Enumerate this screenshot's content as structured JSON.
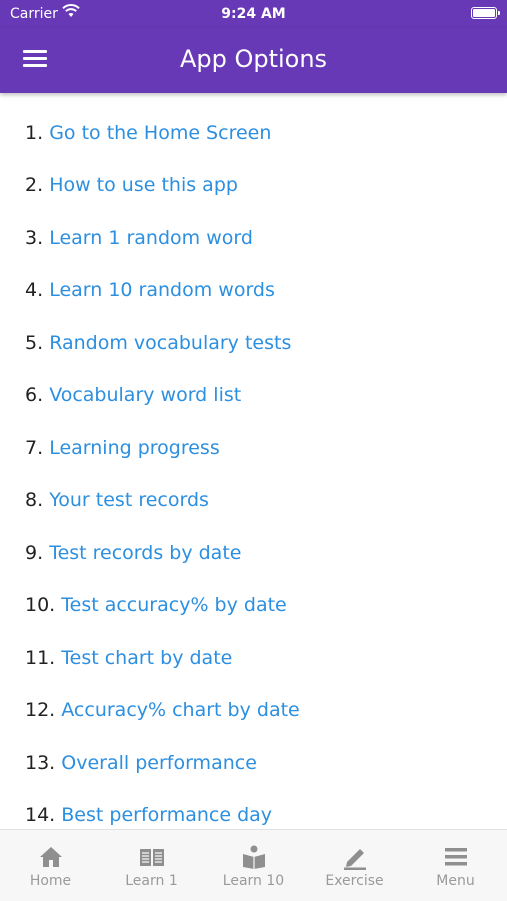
{
  "status_bar": {
    "carrier": "Carrier",
    "time": "9:24 AM"
  },
  "header": {
    "title": "App Options"
  },
  "options": [
    {
      "number": "1.",
      "label": "Go to the Home Screen"
    },
    {
      "number": "2.",
      "label": "How to use this app"
    },
    {
      "number": "3.",
      "label": "Learn 1 random word"
    },
    {
      "number": "4.",
      "label": "Learn 10 random words"
    },
    {
      "number": "5.",
      "label": "Random vocabulary tests"
    },
    {
      "number": "6.",
      "label": "Vocabulary word list"
    },
    {
      "number": "7.",
      "label": "Learning progress"
    },
    {
      "number": "8.",
      "label": "Your test records"
    },
    {
      "number": "9.",
      "label": "Test records by date"
    },
    {
      "number": "10.",
      "label": "Test accuracy% by date"
    },
    {
      "number": "11.",
      "label": "Test chart by date"
    },
    {
      "number": "12.",
      "label": "Accuracy% chart by date"
    },
    {
      "number": "13.",
      "label": "Overall performance"
    },
    {
      "number": "14.",
      "label": "Best performance day"
    }
  ],
  "tab_bar": [
    {
      "label": "Home",
      "icon": "home-icon"
    },
    {
      "label": "Learn 1",
      "icon": "book-icon"
    },
    {
      "label": "Learn 10",
      "icon": "reader-icon"
    },
    {
      "label": "Exercise",
      "icon": "pencil-icon"
    },
    {
      "label": "Menu",
      "icon": "menu-icon"
    }
  ],
  "colors": {
    "header": "#6739b6",
    "link": "#2c8fe0",
    "tab_inactive": "#9a9a9a"
  }
}
